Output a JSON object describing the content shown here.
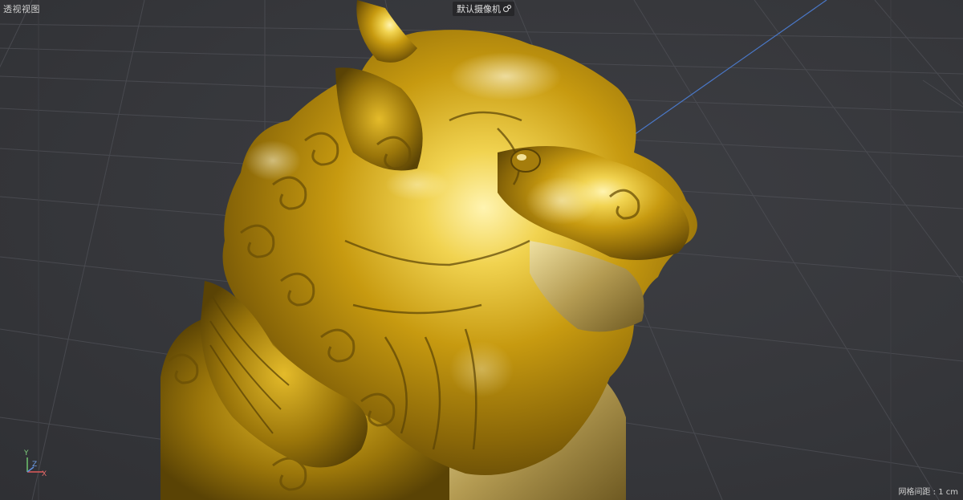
{
  "viewport": {
    "label": "透视视图",
    "camera_menu_label": "默认摄像机",
    "camera_icon": "camera-icon",
    "grid_spacing_text": "网格间距 : 1 cm"
  },
  "axis_gizmo": {
    "y": "Y",
    "z": "Z",
    "x": "X"
  },
  "colors": {
    "background": "#36373b",
    "grid_line": "#4a4b50",
    "gold": "#d4a81a",
    "axis_blue_line": "#4a78c8"
  }
}
